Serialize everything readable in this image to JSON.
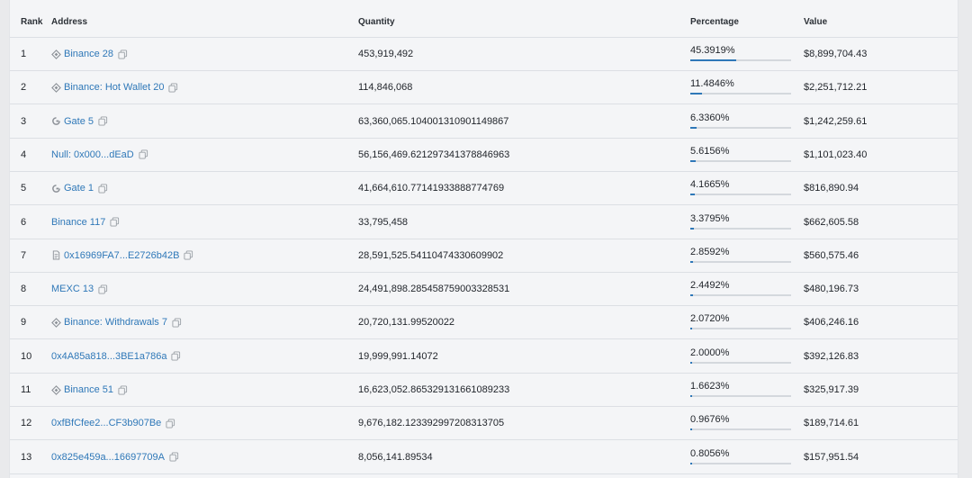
{
  "table": {
    "headers": {
      "rank": "Rank",
      "address": "Address",
      "quantity": "Quantity",
      "percentage": "Percentage",
      "value": "Value"
    },
    "colors": {
      "link": "#2f78b8",
      "bar_fill": "#2f78b8",
      "bar_track": "#d4d8dd"
    },
    "rows": [
      {
        "rank": "1",
        "icon": "binance-icon",
        "address": "Binance 28",
        "quantity": "453,919,492",
        "percentage": "45.3919%",
        "pct_value": 45.3919,
        "value": "$8,899,704.43"
      },
      {
        "rank": "2",
        "icon": "binance-icon",
        "address": "Binance: Hot Wallet 20",
        "quantity": "114,846,068",
        "percentage": "11.4846%",
        "pct_value": 11.4846,
        "value": "$2,251,712.21"
      },
      {
        "rank": "3",
        "icon": "gate-icon",
        "address": "Gate 5",
        "quantity": "63,360,065.104001310901149867",
        "percentage": "6.3360%",
        "pct_value": 6.336,
        "value": "$1,242,259.61"
      },
      {
        "rank": "4",
        "icon": "",
        "address": "Null: 0x000...dEaD",
        "quantity": "56,156,469.621297341378846963",
        "percentage": "5.6156%",
        "pct_value": 5.6156,
        "value": "$1,101,023.40"
      },
      {
        "rank": "5",
        "icon": "gate-icon",
        "address": "Gate 1",
        "quantity": "41,664,610.77141933888774769",
        "percentage": "4.1665%",
        "pct_value": 4.1665,
        "value": "$816,890.94"
      },
      {
        "rank": "6",
        "icon": "",
        "address": "Binance 117",
        "quantity": "33,795,458",
        "percentage": "3.3795%",
        "pct_value": 3.3795,
        "value": "$662,605.58"
      },
      {
        "rank": "7",
        "icon": "contract-file-icon",
        "address": "0x16969FA7...E2726b42B",
        "quantity": "28,591,525.54110474330609902",
        "percentage": "2.8592%",
        "pct_value": 2.8592,
        "value": "$560,575.46"
      },
      {
        "rank": "8",
        "icon": "",
        "address": "MEXC 13",
        "quantity": "24,491,898.285458759003328531",
        "percentage": "2.4492%",
        "pct_value": 2.4492,
        "value": "$480,196.73"
      },
      {
        "rank": "9",
        "icon": "binance-icon",
        "address": "Binance: Withdrawals 7",
        "quantity": "20,720,131.99520022",
        "percentage": "2.0720%",
        "pct_value": 2.072,
        "value": "$406,246.16"
      },
      {
        "rank": "10",
        "icon": "",
        "address": "0x4A85a818...3BE1a786a",
        "quantity": "19,999,991.14072",
        "percentage": "2.0000%",
        "pct_value": 2.0,
        "value": "$392,126.83"
      },
      {
        "rank": "11",
        "icon": "binance-icon",
        "address": "Binance 51",
        "quantity": "16,623,052.865329131661089233",
        "percentage": "1.6623%",
        "pct_value": 1.6623,
        "value": "$325,917.39"
      },
      {
        "rank": "12",
        "icon": "",
        "address": "0xfBfCfee2...CF3b907Be",
        "quantity": "9,676,182.123392997208313705",
        "percentage": "0.9676%",
        "pct_value": 0.9676,
        "value": "$189,714.61"
      },
      {
        "rank": "13",
        "icon": "",
        "address": "0x825e459a...16697709A",
        "quantity": "8,056,141.89534",
        "percentage": "0.8056%",
        "pct_value": 0.8056,
        "value": "$157,951.54"
      }
    ]
  }
}
